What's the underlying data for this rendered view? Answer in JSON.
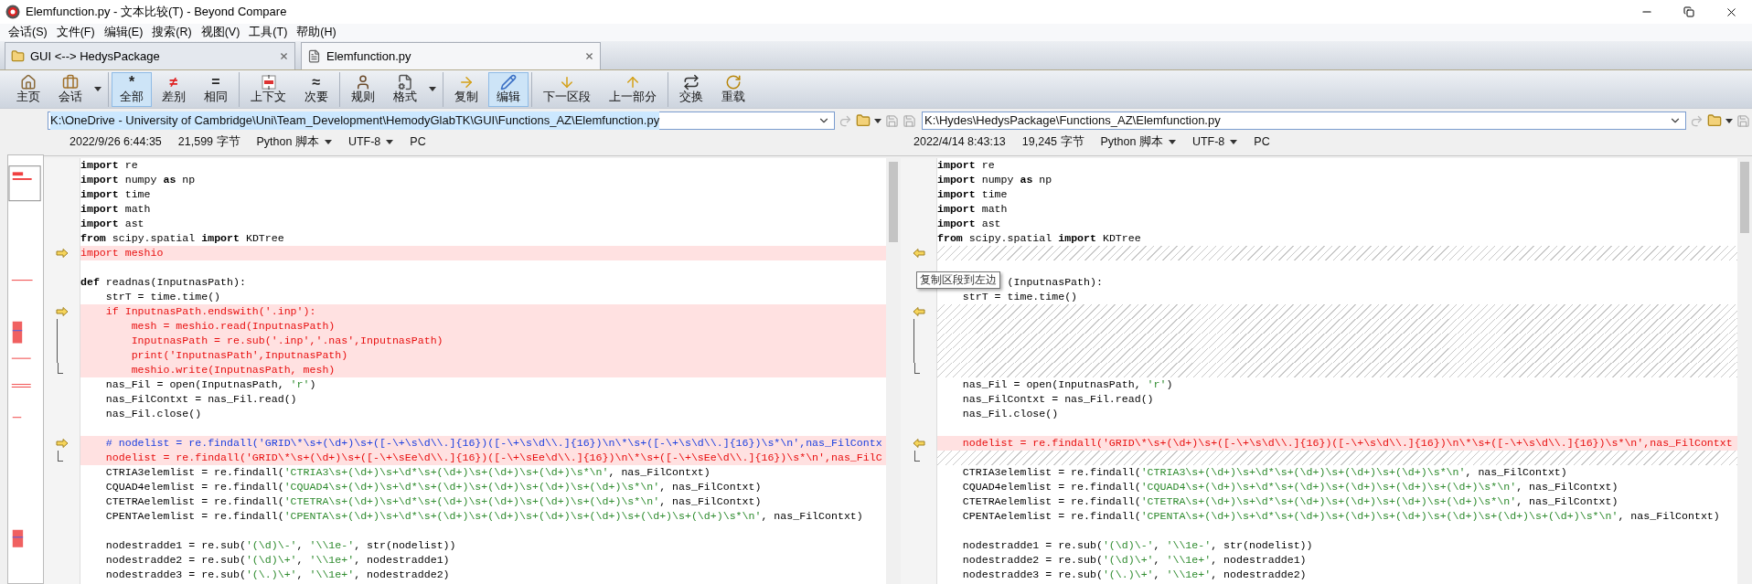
{
  "window": {
    "title": "Elemfunction.py - 文本比较(T) - Beyond Compare"
  },
  "menu": [
    "会话(S)",
    "文件(F)",
    "编辑(E)",
    "搜索(R)",
    "视图(V)",
    "工具(T)",
    "帮助(H)"
  ],
  "tabs": [
    {
      "label": "GUI <--> HedysPackage",
      "selected": false,
      "kind": "folder"
    },
    {
      "label": "Elemfunction.py",
      "selected": true,
      "kind": "file"
    }
  ],
  "toolbar": {
    "groups": [
      [
        {
          "label": "主页",
          "selected": false,
          "dropdown": false
        },
        {
          "label": "会话",
          "selected": false,
          "dropdown": true
        }
      ],
      [
        {
          "label": "全部",
          "glyph": "*",
          "selected": true,
          "dropdown": false
        },
        {
          "label": "差别",
          "glyph": "≠",
          "color": "#e02020",
          "selected": false,
          "dropdown": false
        },
        {
          "label": "相同",
          "glyph": "=",
          "selected": false,
          "dropdown": false
        }
      ],
      [
        {
          "label": "上下文",
          "selected": false,
          "dropdown": false
        },
        {
          "label": "次要",
          "glyph": "≈",
          "selected": false,
          "dropdown": false
        }
      ],
      [
        {
          "label": "规则",
          "selected": false,
          "dropdown": false
        },
        {
          "label": "格式",
          "selected": false,
          "dropdown": true
        }
      ],
      [
        {
          "label": "复制",
          "selected": false,
          "dropdown": false
        },
        {
          "label": "编辑",
          "selected": true,
          "dropdown": false
        }
      ],
      [
        {
          "label": "下一区段",
          "selected": false,
          "dropdown": false
        },
        {
          "label": "上一部分",
          "selected": false,
          "dropdown": false
        }
      ],
      [
        {
          "label": "交换",
          "selected": false,
          "dropdown": false
        },
        {
          "label": "重载",
          "selected": false,
          "dropdown": false
        }
      ]
    ]
  },
  "left": {
    "path": "K:\\OneDrive - University of Cambridge\\Uni\\Team_Development\\HemodyGlabTK\\GUI\\Functions_AZ\\Elemfunction.py",
    "path_selected": true,
    "info": {
      "date": "2022/9/26 6:44:35",
      "size": "21,599 字节",
      "format": "Python 脚本",
      "encoding": "UTF-8",
      "line_ending": "PC"
    },
    "lines": [
      {
        "kind": "same",
        "arrow": false,
        "bracket": false,
        "segments": [
          {
            "text": "import",
            "kind": "kw"
          },
          {
            "text": " re",
            "kind": "plain"
          }
        ]
      },
      {
        "kind": "same",
        "arrow": false,
        "bracket": false,
        "segments": [
          {
            "text": "import",
            "kind": "kw"
          },
          {
            "text": " numpy ",
            "kind": "plain"
          },
          {
            "text": "as",
            "kind": "kw"
          },
          {
            "text": " np",
            "kind": "plain"
          }
        ]
      },
      {
        "kind": "same",
        "arrow": false,
        "bracket": false,
        "segments": [
          {
            "text": "import",
            "kind": "kw"
          },
          {
            "text": " time",
            "kind": "plain"
          }
        ]
      },
      {
        "kind": "same",
        "arrow": false,
        "bracket": false,
        "segments": [
          {
            "text": "import",
            "kind": "kw"
          },
          {
            "text": " math",
            "kind": "plain"
          }
        ]
      },
      {
        "kind": "same",
        "arrow": false,
        "bracket": false,
        "segments": [
          {
            "text": "import",
            "kind": "kw"
          },
          {
            "text": " ast",
            "kind": "plain"
          }
        ]
      },
      {
        "kind": "same",
        "arrow": false,
        "bracket": false,
        "segments": [
          {
            "text": "from",
            "kind": "kw"
          },
          {
            "text": " scipy.spatial ",
            "kind": "plain"
          },
          {
            "text": "import",
            "kind": "kw"
          },
          {
            "text": " KDTree",
            "kind": "plain"
          }
        ]
      },
      {
        "kind": "changed",
        "arrow": true,
        "bracket": false,
        "segments": [
          {
            "text": "import meshio",
            "kind": "plain"
          }
        ]
      },
      {
        "kind": "same",
        "arrow": false,
        "bracket": false
      },
      {
        "kind": "same",
        "arrow": false,
        "bracket": false,
        "segments": [
          {
            "text": "def",
            "kind": "kw"
          },
          {
            "text": " readnas(InputnasPath):",
            "kind": "plain"
          }
        ]
      },
      {
        "kind": "same",
        "arrow": false,
        "bracket": false,
        "segments": [
          {
            "text": "    strT = time.time()",
            "kind": "plain"
          }
        ]
      },
      {
        "kind": "changed",
        "arrow": true,
        "bracket": false,
        "segments": [
          {
            "text": "    if InputnasPath.endswith('.inp'):",
            "kind": "plain"
          }
        ]
      },
      {
        "kind": "changed",
        "arrow": false,
        "bracket": true,
        "segments": [
          {
            "text": "        mesh = meshio.read(InputnasPath)",
            "kind": "plain"
          }
        ]
      },
      {
        "kind": "changed",
        "arrow": false,
        "bracket": true,
        "segments": [
          {
            "text": "        InputnasPath = re.sub('.inp','.nas',InputnasPath)",
            "kind": "plain"
          }
        ]
      },
      {
        "kind": "changed",
        "arrow": false,
        "bracket": true,
        "segments": [
          {
            "text": "        print('InputnasPath',InputnasPath)",
            "kind": "plain"
          }
        ]
      },
      {
        "kind": "changed",
        "arrow": false,
        "bracket": true,
        "segments": [
          {
            "text": "        meshio.write(InputnasPath, mesh)",
            "kind": "plain"
          }
        ]
      },
      {
        "kind": "same",
        "arrow": false,
        "bracket": false,
        "segments": [
          {
            "text": "    nas_Fil = open(InputnasPath, ",
            "kind": "plain"
          },
          {
            "text": "'r'",
            "kind": "str"
          },
          {
            "text": ")",
            "kind": "plain"
          }
        ]
      },
      {
        "kind": "same",
        "arrow": false,
        "bracket": false,
        "segments": [
          {
            "text": "    nas_FilContxt = nas_Fil.read()",
            "kind": "plain"
          }
        ]
      },
      {
        "kind": "same",
        "arrow": false,
        "bracket": false,
        "segments": [
          {
            "text": "    nas_Fil.close()",
            "kind": "plain"
          }
        ]
      },
      {
        "kind": "same",
        "arrow": false,
        "bracket": false
      },
      {
        "kind": "changed",
        "arrow": true,
        "bracket": false,
        "segments": [
          {
            "text": "    # nodelist = re.findall('GRID\\*\\s+(\\d+)\\s+([-\\+\\s\\d\\\\.]{16})([-\\+\\s\\d\\\\.]{16})\\n\\*\\s+([-\\+\\s\\d\\\\.]{16})\\s*\\n',nas_FilContx",
            "kind": "comment"
          }
        ]
      },
      {
        "kind": "changed",
        "arrow": false,
        "bracket": true,
        "segments": [
          {
            "text": "    nodelist = re.findall('GRID\\*\\s+(\\d+)\\s+([-\\+\\sEe\\d\\\\.]{16})([-\\+\\sEe\\d\\\\.]{16})\\n\\*\\s+([-\\+\\sEe\\d\\\\.]{16})\\s*\\n',nas_FilC",
            "kind": "plain"
          }
        ]
      },
      {
        "kind": "same",
        "arrow": false,
        "bracket": false,
        "segments": [
          {
            "text": "    CTRIA3elemlist = re.findall(",
            "kind": "plain"
          },
          {
            "text": "'CTRIA3\\s+(\\d+)\\s+\\d*\\s+(\\d+)\\s+(\\d+)\\s+(\\d+)\\s*\\n'",
            "kind": "str"
          },
          {
            "text": ", nas_FilContxt)",
            "kind": "plain"
          }
        ]
      },
      {
        "kind": "same",
        "arrow": false,
        "bracket": false,
        "segments": [
          {
            "text": "    CQUAD4elemlist = re.findall(",
            "kind": "plain"
          },
          {
            "text": "'CQUAD4\\s+(\\d+)\\s+\\d*\\s+(\\d+)\\s+(\\d+)\\s+(\\d+)\\s+(\\d+)\\s*\\n'",
            "kind": "str"
          },
          {
            "text": ", nas_FilContxt)",
            "kind": "plain"
          }
        ]
      },
      {
        "kind": "same",
        "arrow": false,
        "bracket": false,
        "segments": [
          {
            "text": "    CTETRAelemlist = re.findall(",
            "kind": "plain"
          },
          {
            "text": "'CTETRA\\s+(\\d+)\\s+\\d*\\s+(\\d+)\\s+(\\d+)\\s+(\\d+)\\s+(\\d+)\\s*\\n'",
            "kind": "str"
          },
          {
            "text": ", nas_FilContxt)",
            "kind": "plain"
          }
        ]
      },
      {
        "kind": "same",
        "arrow": false,
        "bracket": false,
        "segments": [
          {
            "text": "    CPENTAelemlist = re.findall(",
            "kind": "plain"
          },
          {
            "text": "'CPENTA\\s+(\\d+)\\s+\\d*\\s+(\\d+)\\s+(\\d+)\\s+(\\d+)\\s+(\\d+)\\s+(\\d+)\\s+(\\d+)\\s*\\n'",
            "kind": "str"
          },
          {
            "text": ", nas_FilContxt)",
            "kind": "plain"
          }
        ]
      },
      {
        "kind": "same",
        "arrow": false,
        "bracket": false
      },
      {
        "kind": "same",
        "arrow": false,
        "bracket": false,
        "segments": [
          {
            "text": "    nodestradde1 = re.sub(",
            "kind": "plain"
          },
          {
            "text": "'(\\d)\\-'",
            "kind": "str"
          },
          {
            "text": ", ",
            "kind": "plain"
          },
          {
            "text": "'\\\\1e-'",
            "kind": "str"
          },
          {
            "text": ", str(nodelist))",
            "kind": "plain"
          }
        ]
      },
      {
        "kind": "same",
        "arrow": false,
        "bracket": false,
        "segments": [
          {
            "text": "    nodestradde2 = re.sub(",
            "kind": "plain"
          },
          {
            "text": "'(\\d)\\+'",
            "kind": "str"
          },
          {
            "text": ", ",
            "kind": "plain"
          },
          {
            "text": "'\\\\1e+'",
            "kind": "str"
          },
          {
            "text": ", nodestradde1)",
            "kind": "plain"
          }
        ]
      },
      {
        "kind": "same",
        "arrow": false,
        "bracket": false,
        "segments": [
          {
            "text": "    nodestradde3 = re.sub(",
            "kind": "plain"
          },
          {
            "text": "'(\\.)\\+'",
            "kind": "str"
          },
          {
            "text": ", ",
            "kind": "plain"
          },
          {
            "text": "'\\\\1e+'",
            "kind": "str"
          },
          {
            "text": ", nodestradde2)",
            "kind": "plain"
          }
        ]
      }
    ]
  },
  "right": {
    "path": "K:\\Hydes\\HedysPackage\\Functions_AZ\\Elemfunction.py",
    "path_selected": false,
    "info": {
      "date": "2022/4/14 8:43:13",
      "size": "19,245 字节",
      "format": "Python 脚本",
      "encoding": "UTF-8",
      "line_ending": "PC"
    },
    "tooltip": "复制区段到左边",
    "lines": [
      {
        "kind": "same",
        "arrow": false,
        "bracket": false,
        "segments": [
          {
            "text": "import",
            "kind": "kw"
          },
          {
            "text": " re",
            "kind": "plain"
          }
        ]
      },
      {
        "kind": "same",
        "arrow": false,
        "bracket": false,
        "segments": [
          {
            "text": "import",
            "kind": "kw"
          },
          {
            "text": " numpy ",
            "kind": "plain"
          },
          {
            "text": "as",
            "kind": "kw"
          },
          {
            "text": " np",
            "kind": "plain"
          }
        ]
      },
      {
        "kind": "same",
        "arrow": false,
        "bracket": false,
        "segments": [
          {
            "text": "import",
            "kind": "kw"
          },
          {
            "text": " time",
            "kind": "plain"
          }
        ]
      },
      {
        "kind": "same",
        "arrow": false,
        "bracket": false,
        "segments": [
          {
            "text": "import",
            "kind": "kw"
          },
          {
            "text": " math",
            "kind": "plain"
          }
        ]
      },
      {
        "kind": "same",
        "arrow": false,
        "bracket": false,
        "segments": [
          {
            "text": "import",
            "kind": "kw"
          },
          {
            "text": " ast",
            "kind": "plain"
          }
        ]
      },
      {
        "kind": "same",
        "arrow": false,
        "bracket": false,
        "segments": [
          {
            "text": "from",
            "kind": "kw"
          },
          {
            "text": " scipy.spatial ",
            "kind": "plain"
          },
          {
            "text": "import",
            "kind": "kw"
          },
          {
            "text": " KDTree",
            "kind": "plain"
          }
        ]
      },
      {
        "kind": "missing",
        "arrow": true,
        "bracket": false
      },
      {
        "kind": "same",
        "arrow": false,
        "bracket": false
      },
      {
        "kind": "covered",
        "arrow": false,
        "bracket": false,
        "segments": [
          {
            "text": "(InputnasPath):",
            "kind": "plain"
          }
        ]
      },
      {
        "kind": "same",
        "arrow": false,
        "bracket": false,
        "segments": [
          {
            "text": "    strT = time.time()",
            "kind": "plain"
          }
        ]
      },
      {
        "kind": "missing",
        "arrow": true,
        "bracket": false
      },
      {
        "kind": "missing",
        "arrow": false,
        "bracket": true
      },
      {
        "kind": "missing",
        "arrow": false,
        "bracket": true
      },
      {
        "kind": "missing",
        "arrow": false,
        "bracket": true
      },
      {
        "kind": "missing",
        "arrow": false,
        "bracket": true
      },
      {
        "kind": "same",
        "arrow": false,
        "bracket": false,
        "segments": [
          {
            "text": "    nas_Fil = open(InputnasPath, ",
            "kind": "plain"
          },
          {
            "text": "'r'",
            "kind": "str"
          },
          {
            "text": ")",
            "kind": "plain"
          }
        ]
      },
      {
        "kind": "same",
        "arrow": false,
        "bracket": false,
        "segments": [
          {
            "text": "    nas_FilContxt = nas_Fil.read()",
            "kind": "plain"
          }
        ]
      },
      {
        "kind": "same",
        "arrow": false,
        "bracket": false,
        "segments": [
          {
            "text": "    nas_Fil.close()",
            "kind": "plain"
          }
        ]
      },
      {
        "kind": "same",
        "arrow": false,
        "bracket": false
      },
      {
        "kind": "changed",
        "arrow": true,
        "bracket": false,
        "segments": [
          {
            "text": "    nodelist = re.findall('GRID\\*\\s+(\\d+)\\s+([-\\+\\s\\d\\\\.]{16})([-\\+\\s\\d\\\\.]{16})\\n\\*\\s+([-\\+\\s\\d\\\\.]{16})\\s*\\n',nas_FilContxt",
            "kind": "plain"
          }
        ]
      },
      {
        "kind": "missing",
        "arrow": false,
        "bracket": true
      },
      {
        "kind": "same",
        "arrow": false,
        "bracket": false,
        "segments": [
          {
            "text": "    CTRIA3elemlist = re.findall(",
            "kind": "plain"
          },
          {
            "text": "'CTRIA3\\s+(\\d+)\\s+\\d*\\s+(\\d+)\\s+(\\d+)\\s+(\\d+)\\s*\\n'",
            "kind": "str"
          },
          {
            "text": ", nas_FilContxt)",
            "kind": "plain"
          }
        ]
      },
      {
        "kind": "same",
        "arrow": false,
        "bracket": false,
        "segments": [
          {
            "text": "    CQUAD4elemlist = re.findall(",
            "kind": "plain"
          },
          {
            "text": "'CQUAD4\\s+(\\d+)\\s+\\d*\\s+(\\d+)\\s+(\\d+)\\s+(\\d+)\\s+(\\d+)\\s*\\n'",
            "kind": "str"
          },
          {
            "text": ", nas_FilContxt)",
            "kind": "plain"
          }
        ]
      },
      {
        "kind": "same",
        "arrow": false,
        "bracket": false,
        "segments": [
          {
            "text": "    CTETRAelemlist = re.findall(",
            "kind": "plain"
          },
          {
            "text": "'CTETRA\\s+(\\d+)\\s+\\d*\\s+(\\d+)\\s+(\\d+)\\s+(\\d+)\\s+(\\d+)\\s*\\n'",
            "kind": "str"
          },
          {
            "text": ", nas_FilContxt)",
            "kind": "plain"
          }
        ]
      },
      {
        "kind": "same",
        "arrow": false,
        "bracket": false,
        "segments": [
          {
            "text": "    CPENTAelemlist = re.findall(",
            "kind": "plain"
          },
          {
            "text": "'CPENTA\\s+(\\d+)\\s+\\d*\\s+(\\d+)\\s+(\\d+)\\s+(\\d+)\\s+(\\d+)\\s+(\\d+)\\s+(\\d+)\\s*\\n'",
            "kind": "str"
          },
          {
            "text": ", nas_FilContxt)",
            "kind": "plain"
          }
        ]
      },
      {
        "kind": "same",
        "arrow": false,
        "bracket": false
      },
      {
        "kind": "same",
        "arrow": false,
        "bracket": false,
        "segments": [
          {
            "text": "    nodestradde1 = re.sub(",
            "kind": "plain"
          },
          {
            "text": "'(\\d)\\-'",
            "kind": "str"
          },
          {
            "text": ", ",
            "kind": "plain"
          },
          {
            "text": "'\\\\1e-'",
            "kind": "str"
          },
          {
            "text": ", str(nodelist))",
            "kind": "plain"
          }
        ]
      },
      {
        "kind": "same",
        "arrow": false,
        "bracket": false,
        "segments": [
          {
            "text": "    nodestradde2 = re.sub(",
            "kind": "plain"
          },
          {
            "text": "'(\\d)\\+'",
            "kind": "str"
          },
          {
            "text": ", ",
            "kind": "plain"
          },
          {
            "text": "'\\\\1e+'",
            "kind": "str"
          },
          {
            "text": ", nodestradde1)",
            "kind": "plain"
          }
        ]
      },
      {
        "kind": "same",
        "arrow": false,
        "bracket": false,
        "segments": [
          {
            "text": "    nodestradde3 = re.sub(",
            "kind": "plain"
          },
          {
            "text": "'(\\.)\\+'",
            "kind": "str"
          },
          {
            "text": ", ",
            "kind": "plain"
          },
          {
            "text": "'\\\\1e+'",
            "kind": "str"
          },
          {
            "text": ", nodestradde2)",
            "kind": "plain"
          }
        ]
      }
    ]
  }
}
